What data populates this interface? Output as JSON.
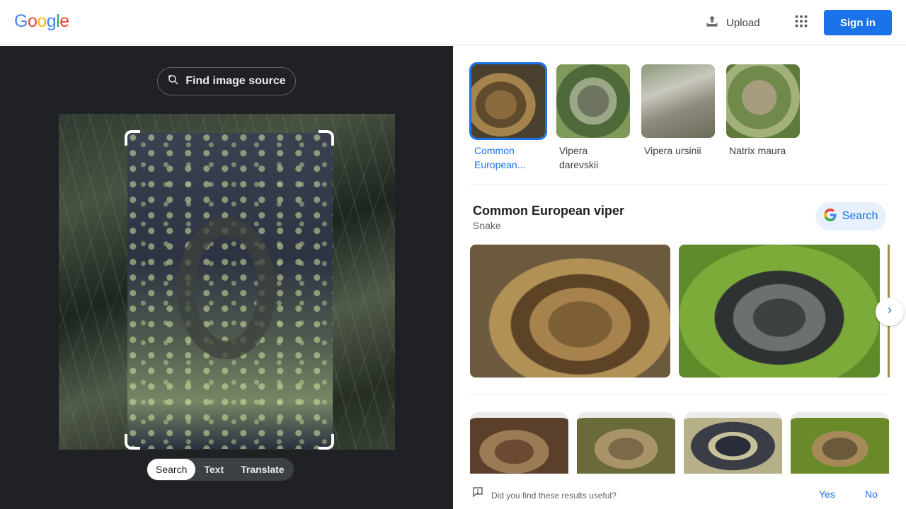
{
  "header": {
    "logo_letters": [
      {
        "ch": "G",
        "color": "#4285F4"
      },
      {
        "ch": "o",
        "color": "#EA4335"
      },
      {
        "ch": "o",
        "color": "#FBBC05"
      },
      {
        "ch": "g",
        "color": "#4285F4"
      },
      {
        "ch": "l",
        "color": "#34A853"
      },
      {
        "ch": "e",
        "color": "#EA4335"
      }
    ],
    "upload_label": "Upload",
    "upload_icon": "upload-icon",
    "apps_icon": "apps-grid-icon",
    "signin_label": "Sign in"
  },
  "left_panel": {
    "find_source_label": "Find image source",
    "find_source_icon": "lens-search-icon",
    "modes": [
      {
        "label": "Search",
        "active": true
      },
      {
        "label": "Text",
        "active": false
      },
      {
        "label": "Translate",
        "active": false
      }
    ]
  },
  "right_panel": {
    "related": [
      {
        "caption": "Common European...",
        "selected": true
      },
      {
        "caption": "Vipera darevskii",
        "selected": false
      },
      {
        "caption": "Vipera ursinii",
        "selected": false
      },
      {
        "caption": "Natrix maura",
        "selected": false
      }
    ],
    "entity": {
      "title": "Common European viper",
      "subtitle": "Snake",
      "search_label": "Search"
    },
    "next_icon": "chevron-right-icon",
    "feedback": {
      "question": "Did you find these results useful?",
      "yes": "Yes",
      "no": "No"
    }
  },
  "colors": {
    "accent": "#1a73e8",
    "left_bg": "#202124",
    "chip_bg": "#e8f0fe"
  }
}
